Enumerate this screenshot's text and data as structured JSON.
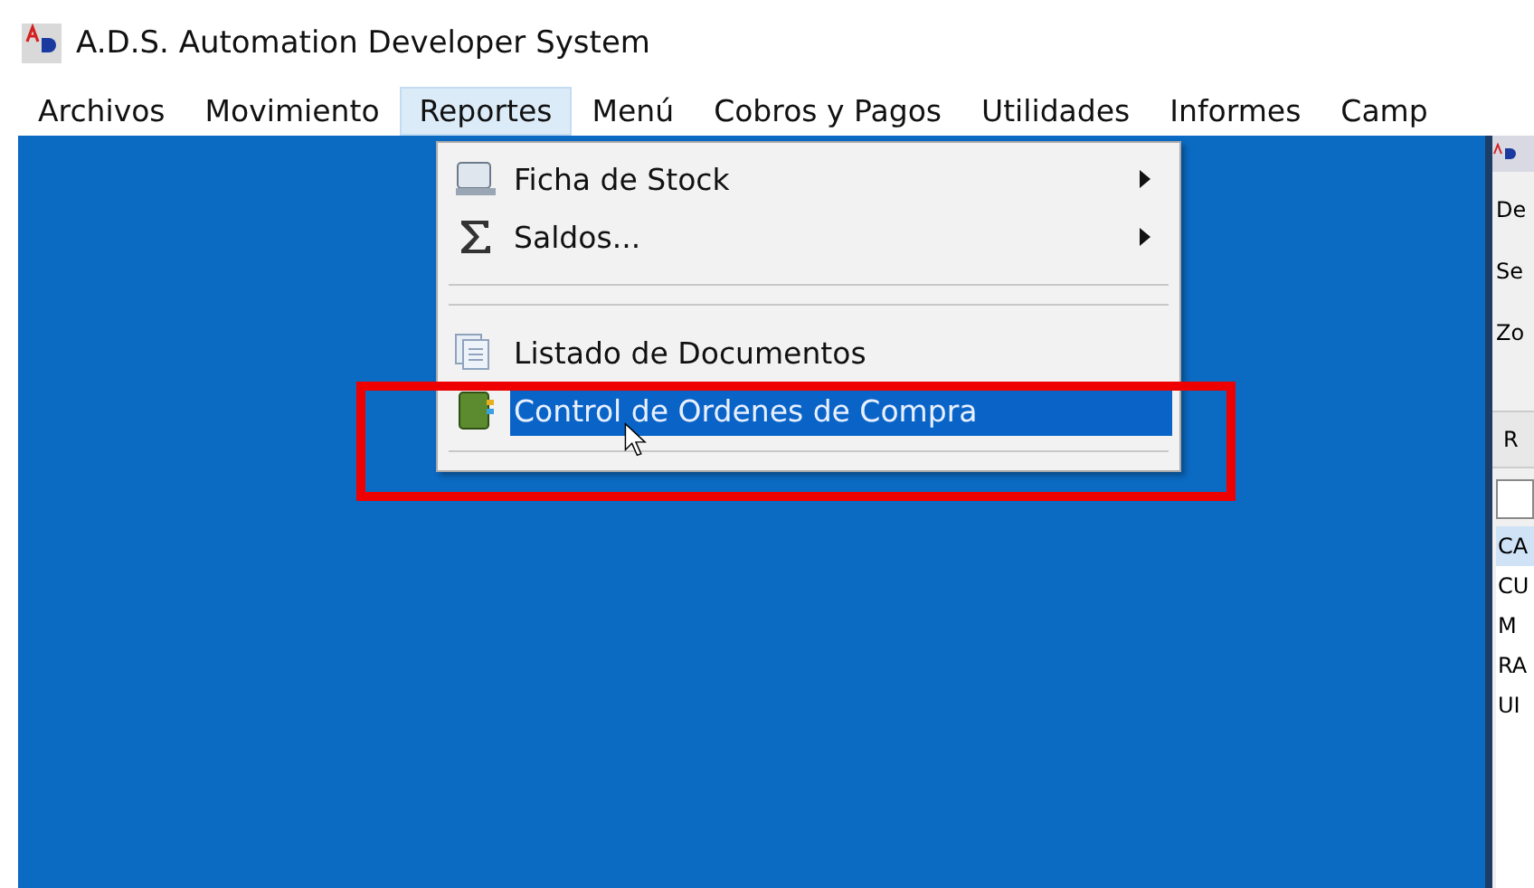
{
  "window": {
    "title": "A.D.S. Automation Developer System"
  },
  "menu_bar": [
    {
      "label": "Archivos",
      "selected": false
    },
    {
      "label": "Movimiento",
      "selected": false
    },
    {
      "label": "Reportes",
      "selected": true
    },
    {
      "label": "Menú",
      "selected": false
    },
    {
      "label": "Cobros y Pagos",
      "selected": false
    },
    {
      "label": "Utilidades",
      "selected": false
    },
    {
      "label": "Informes",
      "selected": false
    },
    {
      "label": "Camp",
      "selected": false
    }
  ],
  "dropdown": [
    {
      "kind": "item",
      "label": "Ficha de Stock",
      "submenu": true,
      "selected": false
    },
    {
      "kind": "item",
      "label": "Saldos...",
      "submenu": true,
      "selected": false
    },
    {
      "kind": "separator"
    },
    {
      "kind": "separator"
    },
    {
      "kind": "item",
      "label": "Listado de Documentos",
      "submenu": false,
      "selected": false
    },
    {
      "kind": "item",
      "label": "Control de Ordenes de Compra",
      "submenu": false,
      "selected": true
    },
    {
      "kind": "separator"
    }
  ],
  "side_window": {
    "fields": [
      "De",
      "Se",
      "Zo"
    ],
    "section": "R",
    "list": [
      {
        "label": "CA",
        "selected": true
      },
      {
        "label": "CU",
        "selected": false
      },
      {
        "label": "M",
        "selected": false
      },
      {
        "label": "RA",
        "selected": false
      },
      {
        "label": "UI",
        "selected": false
      }
    ]
  }
}
